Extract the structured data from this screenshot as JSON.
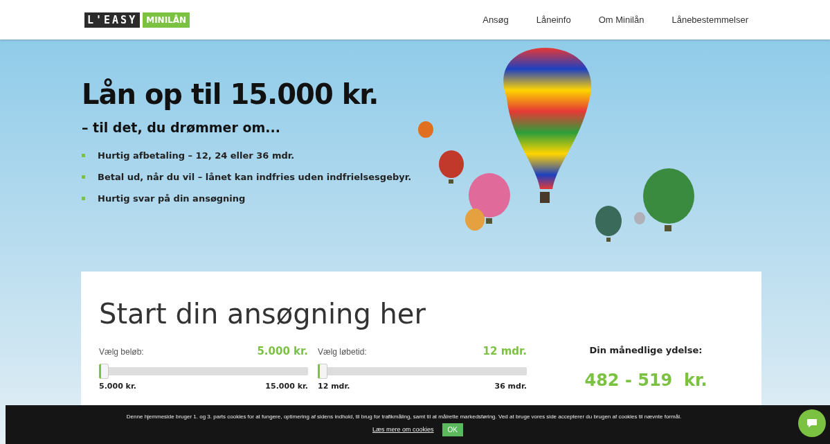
{
  "header": {
    "logo": {
      "brand": "L'EASY",
      "product": "MINILÅN"
    },
    "nav": [
      {
        "label": "Ansøg"
      },
      {
        "label": "Låneinfo"
      },
      {
        "label": "Om Minilån"
      },
      {
        "label": "Lånebestemmelser"
      }
    ]
  },
  "hero": {
    "title": "Lån op til 15.000 kr.",
    "subtitle": "– til det, du drømmer om...",
    "bullets": [
      "Hurtig afbetaling – 12, 24 eller 36 mdr.",
      "Betal ud, når du vil – lånet kan indfries uden indfrielsesgebyr.",
      "Hurtig svar på din ansøgning"
    ]
  },
  "calculator": {
    "title": "Start din ansøgning her",
    "sliders": [
      {
        "label": "Vælg beløb:",
        "value": "5.000 kr.",
        "level": 0,
        "min": "5.000 kr.",
        "max": "15.000 kr."
      },
      {
        "label": "Vælg løbetid:",
        "value": "12 mdr.",
        "level": 0,
        "min": "12 mdr.",
        "max": "36 mdr."
      }
    ],
    "result": {
      "label": "Din månedlige ydelse:",
      "value": "482 - 519  kr."
    }
  },
  "cookie_bar": {
    "text": "Denne hjemmeside bruger 1. og 3. parts cookies for at fungere, optimering af sidens indhold, til brug for trafikmåling, samt til at målrette markedsføring. Ved at bruge vores side accepterer du brugen af cookies til nævnte formål.",
    "link": "Læs mere om cookies",
    "button": "OK"
  }
}
